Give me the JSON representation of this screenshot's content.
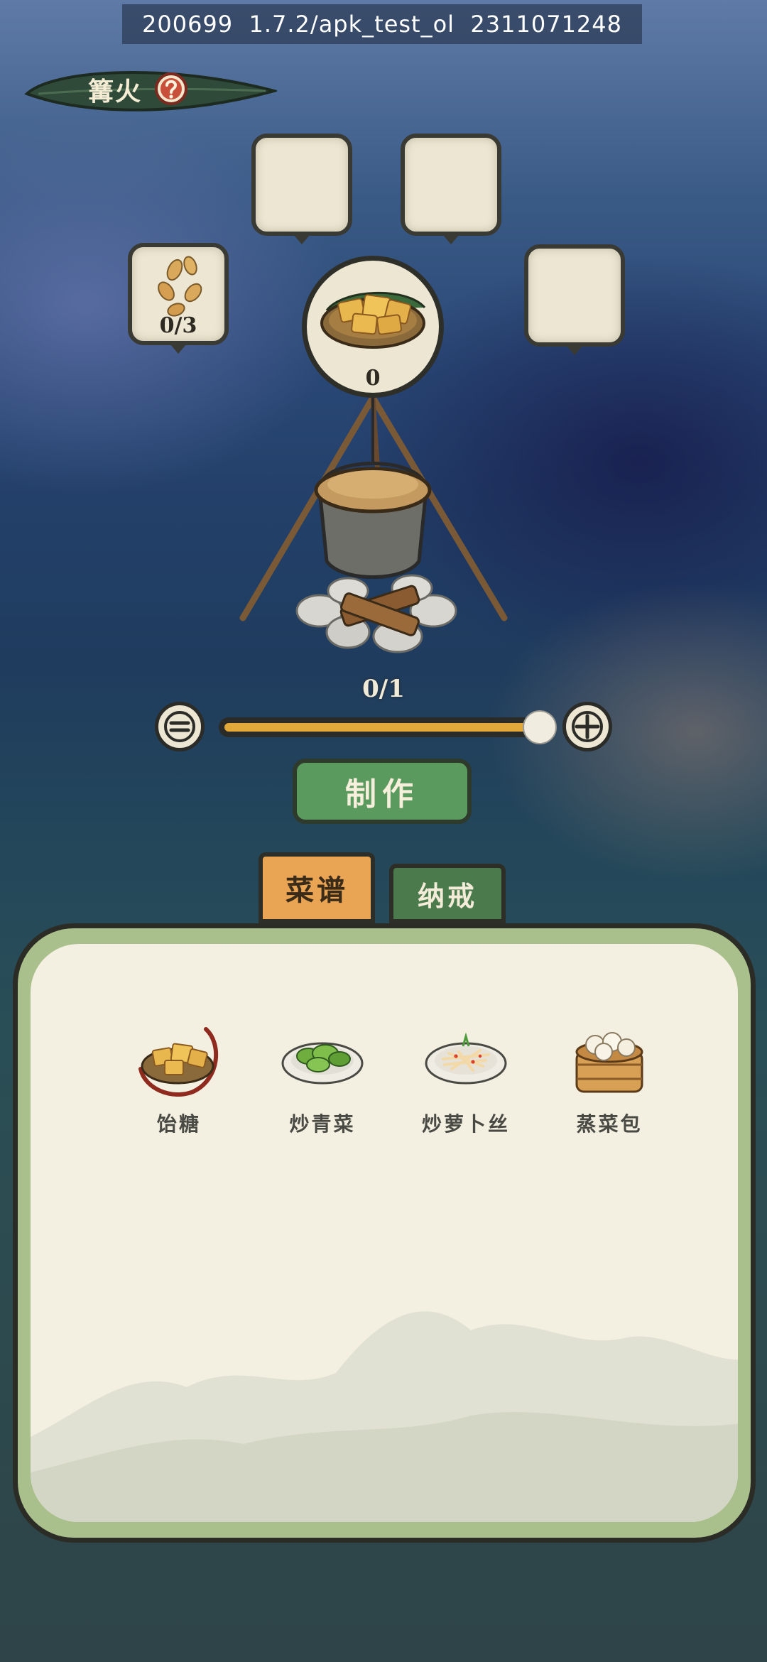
{
  "debug_bar": {
    "text": "200699  1.7.2/apk_test_ol  2311071248"
  },
  "header": {
    "title": "篝火",
    "help_icon": "question-mark-icon"
  },
  "ingredient_slots": {
    "slot1_count": "0/3",
    "slot1_icon": "seed-icon"
  },
  "result": {
    "count": "0",
    "icon": "malt-sugar-dish"
  },
  "quantity": {
    "progress_text": "0/1",
    "slider_fraction": 1.0,
    "minus_icon": "minus-icon",
    "plus_icon": "plus-icon"
  },
  "make_button": {
    "label": "制作"
  },
  "tabs": [
    {
      "label": "菜谱",
      "active": true
    },
    {
      "label": "纳戒",
      "active": false
    }
  ],
  "recipes": [
    {
      "label": "饴糖",
      "icon": "malt-sugar-dish",
      "selected": true
    },
    {
      "label": "炒青菜",
      "icon": "stir-fried-greens-dish",
      "selected": false
    },
    {
      "label": "炒萝卜丝",
      "icon": "shredded-radish-dish",
      "selected": false
    },
    {
      "label": "蒸菜包",
      "icon": "steamed-bun-basket",
      "selected": false
    }
  ],
  "colors": {
    "accent_green": "#5a9a5e",
    "tab_orange": "#e9a454",
    "slider_fill": "#e0a93a",
    "panel_paper": "#f3efe1"
  }
}
